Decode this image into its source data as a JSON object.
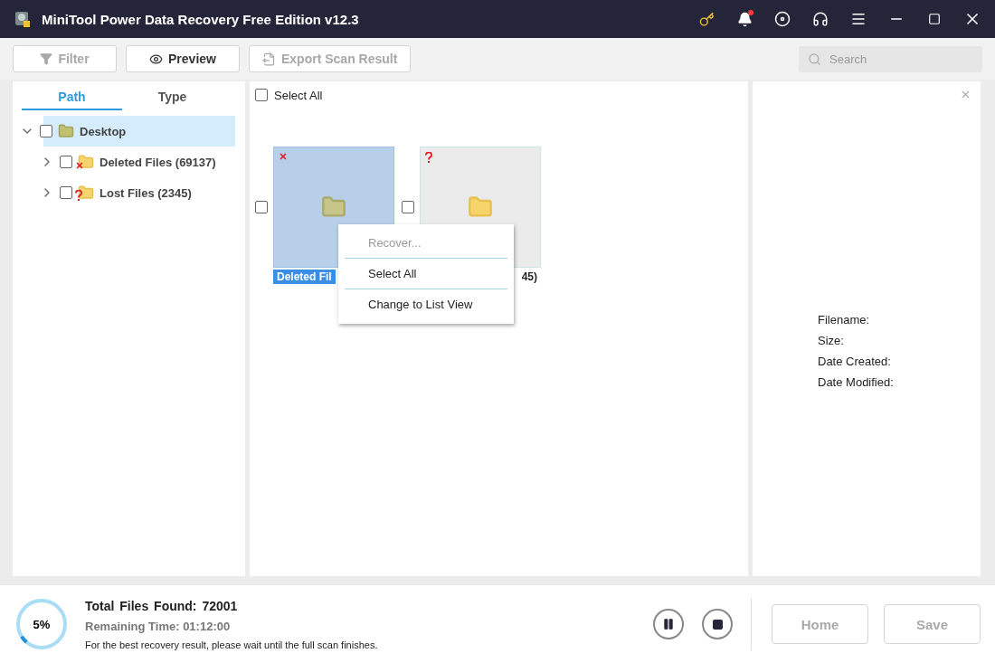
{
  "window": {
    "title": "MiniTool Power Data Recovery Free Edition v12.3",
    "notification": true
  },
  "toolbar": {
    "buttons": [
      {
        "label": "Filter",
        "disabled": true,
        "kind": "filter"
      },
      {
        "label": "Preview",
        "disabled": false,
        "kind": "preview"
      },
      {
        "label": "Export Scan Result",
        "disabled": true,
        "kind": "export"
      }
    ],
    "search": {
      "placeholder": "Search"
    }
  },
  "tabs": [
    {
      "label": "Path",
      "selected": true
    },
    {
      "label": "Type",
      "selected": false
    }
  ],
  "tree": [
    {
      "label": "Desktop",
      "kind": "folder",
      "selected": true,
      "expanded": true,
      "checked": false,
      "children": [
        {
          "label": "Deleted Files (69137)",
          "kind": "deleted",
          "selected": false,
          "expanded": false,
          "checked": false
        },
        {
          "label": "Lost Files (2345)",
          "kind": "lost",
          "selected": false,
          "expanded": false,
          "checked": false
        }
      ]
    }
  ],
  "grid": {
    "select_all": {
      "label": "Select All",
      "checked": false
    },
    "items": [
      {
        "label": "Deleted Fil",
        "kind": "deleted",
        "selected": true,
        "checked": false
      },
      {
        "label": "45)",
        "kind": "lost",
        "selected": false,
        "checked": false
      }
    ]
  },
  "context_menu": [
    {
      "label": "Recover...",
      "disabled": true
    },
    {
      "label": "Select All",
      "disabled": false
    },
    {
      "label": "Change to List View",
      "disabled": false
    }
  ],
  "details": {
    "fields": [
      "Filename:",
      "Size:",
      "Date Created:",
      "Date Modified:"
    ]
  },
  "status": {
    "percent": "5%",
    "level": 0.05,
    "total_label": "Total Files Found:",
    "total": "72001",
    "remaining_label": "Remaining Time:",
    "remaining": "01:12:00",
    "hint": "For the best recovery result, please wait until the full scan finishes."
  },
  "actions": [
    {
      "label": "Home",
      "disabled": true
    },
    {
      "label": "Save",
      "disabled": true
    }
  ]
}
